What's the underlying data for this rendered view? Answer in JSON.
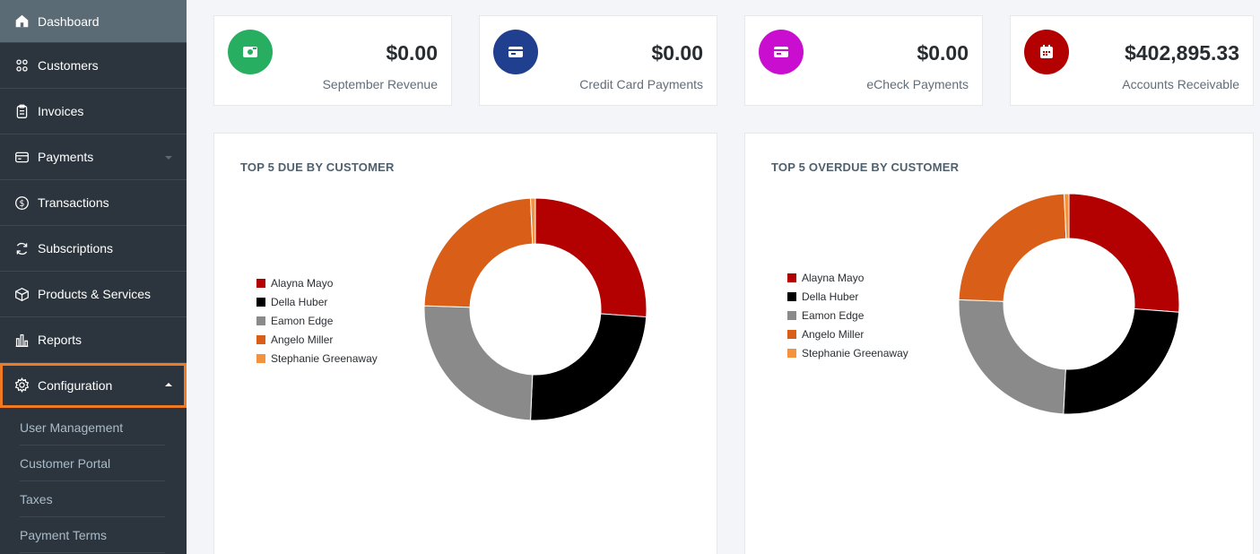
{
  "sidebar": {
    "items": [
      {
        "label": "Dashboard",
        "icon": "home-icon"
      },
      {
        "label": "Customers",
        "icon": "users-icon"
      },
      {
        "label": "Invoices",
        "icon": "clipboard-icon"
      },
      {
        "label": "Payments",
        "icon": "credit-card-icon"
      },
      {
        "label": "Transactions",
        "icon": "dollar-circle-icon"
      },
      {
        "label": "Subscriptions",
        "icon": "refresh-icon"
      },
      {
        "label": "Products & Services",
        "icon": "box-icon"
      },
      {
        "label": "Reports",
        "icon": "bar-chart-icon"
      },
      {
        "label": "Configuration",
        "icon": "gear-icon"
      }
    ],
    "sub_items": [
      {
        "label": "User Management"
      },
      {
        "label": "Customer Portal"
      },
      {
        "label": "Taxes"
      },
      {
        "label": "Payment Terms"
      }
    ]
  },
  "stats": [
    {
      "value": "$0.00",
      "label": "September Revenue",
      "color": "#27ae60",
      "icon": "cash-icon"
    },
    {
      "value": "$0.00",
      "label": "Credit Card Payments",
      "color": "#213f8f",
      "icon": "credit-card-icon"
    },
    {
      "value": "$0.00",
      "label": "eCheck Payments",
      "color": "#c90ed0",
      "icon": "credit-card-icon"
    },
    {
      "value": "$402,895.33",
      "label": "Accounts Receivable",
      "color": "#b30000",
      "icon": "calendar-icon"
    }
  ],
  "chart_data": [
    {
      "type": "pie",
      "title": "TOP 5 DUE BY CUSTOMER",
      "donut": true,
      "legend_placement": "left",
      "categories": [
        "Alayna Mayo",
        "Della Huber",
        "Eamon Edge",
        "Angelo Miller",
        "Stephanie Greenaway"
      ],
      "values": [
        26.1,
        24.6,
        24.8,
        23.8,
        0.7
      ],
      "colors": [
        "#b30000",
        "#000000",
        "#8a8a8a",
        "#d95f18",
        "#f5923e"
      ]
    },
    {
      "type": "pie",
      "title": "TOP 5 OVERDUE BY CUSTOMER",
      "donut": true,
      "legend_placement": "left",
      "categories": [
        "Alayna Mayo",
        "Della Huber",
        "Eamon Edge",
        "Angelo Miller",
        "Stephanie Greenaway"
      ],
      "values": [
        26.2,
        24.6,
        24.8,
        23.7,
        0.7
      ],
      "colors": [
        "#b30000",
        "#000000",
        "#8a8a8a",
        "#d95f18",
        "#f5923e"
      ]
    }
  ]
}
